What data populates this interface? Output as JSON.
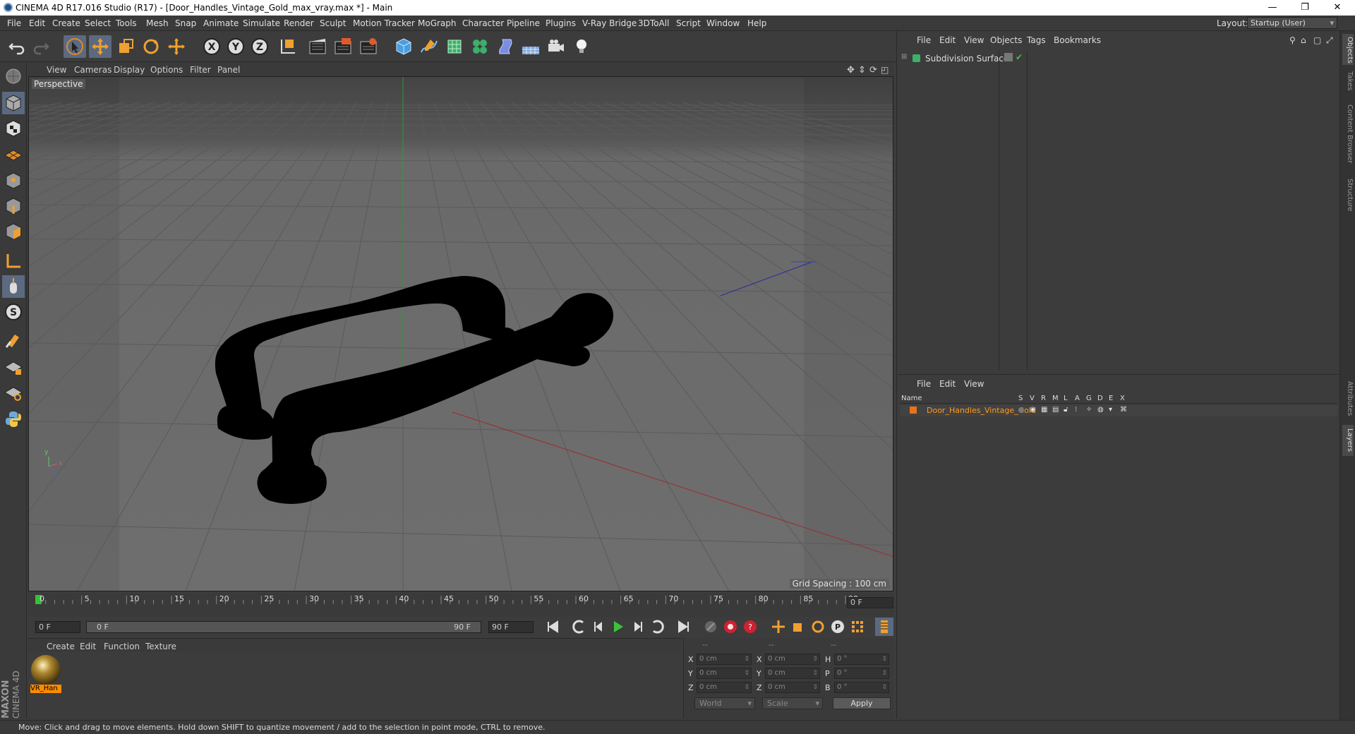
{
  "window": {
    "title": "CINEMA 4D R17.016 Studio (R17) - [Door_Handles_Vintage_Gold_max_vray.max *] - Main",
    "minimize": "—",
    "restore": "❐",
    "close": "✕"
  },
  "menubar": {
    "items": [
      "File",
      "Edit",
      "Create",
      "Select",
      "Tools",
      "Mesh",
      "Snap",
      "Animate",
      "Simulate",
      "Render",
      "Sculpt",
      "Motion Tracker",
      "MoGraph",
      "Character",
      "Pipeline",
      "Plugins",
      "V-Ray Bridge",
      "3DToAll",
      "Script",
      "Window",
      "Help"
    ],
    "layout_label": "Layout:",
    "layout_value": "Startup (User)"
  },
  "toolbar": {
    "icons": [
      "undo-icon",
      "redo-icon",
      "live-selection-icon",
      "move-icon",
      "scale-icon",
      "rotate-icon",
      "recent-tool-icon",
      "x-axis-lock-icon",
      "y-axis-lock-icon",
      "z-axis-lock-icon",
      "coordinate-system-icon",
      "render-view-icon",
      "render-to-picture-viewer-icon",
      "edit-render-settings-icon",
      "cube-object-icon",
      "spline-pen-icon",
      "subdivision-surface-icon",
      "cloner-icon",
      "deformer-icon",
      "floor-icon",
      "camera-icon",
      "light-icon"
    ],
    "axis_labels": [
      "X",
      "Y",
      "Z"
    ]
  },
  "left_tools": [
    "make-editable-icon",
    "model-mode-icon",
    "texture-mode-icon",
    "workplane-mode-icon",
    "points-mode-icon",
    "edges-mode-icon",
    "polygons-mode-icon",
    "axis-mode-icon",
    "tweak-mode-icon",
    "solo-mode-icon",
    "snap-icon",
    "workplane-lock-icon",
    "quantize-icon",
    "python-icon"
  ],
  "viewport": {
    "menu": [
      "View",
      "Cameras",
      "Display",
      "Options",
      "Filter",
      "Panel"
    ],
    "label": "Perspective",
    "grid_spacing": "Grid Spacing : 100 cm",
    "axis_y": "y",
    "axis_x": "x",
    "axis_z": "z"
  },
  "timeline": {
    "ticks": [
      "0",
      "5",
      "10",
      "15",
      "20",
      "25",
      "30",
      "35",
      "40",
      "45",
      "50",
      "55",
      "60",
      "65",
      "70",
      "75",
      "80",
      "85",
      "90"
    ],
    "current_frame_field": "0 F",
    "start_field": "0 F",
    "range_start": "0 F",
    "range_end": "90 F",
    "end_field": "90 F"
  },
  "material_manager": {
    "menu": [
      "Create",
      "Edit",
      "Function",
      "Texture"
    ],
    "material_name": "VR_Han"
  },
  "coordinates": {
    "headers": [
      "--",
      "--",
      "--"
    ],
    "rows": [
      {
        "a": "X",
        "av": "0 cm",
        "b": "X",
        "bv": "0 cm",
        "c": "H",
        "cv": "0 °"
      },
      {
        "a": "Y",
        "av": "0 cm",
        "b": "Y",
        "bv": "0 cm",
        "c": "P",
        "cv": "0 °"
      },
      {
        "a": "Z",
        "av": "0 cm",
        "b": "Z",
        "bv": "0 cm",
        "c": "B",
        "cv": "0 °"
      }
    ],
    "world": "World",
    "scale": "Scale",
    "apply": "Apply"
  },
  "object_manager": {
    "menu": [
      "File",
      "Edit",
      "View",
      "Objects",
      "Tags",
      "Bookmarks"
    ],
    "objects": [
      {
        "name": "Subdivision Surface"
      }
    ]
  },
  "layer_manager": {
    "menu": [
      "File",
      "Edit",
      "View"
    ],
    "columns": [
      "Name",
      "S",
      "V",
      "R",
      "M",
      "L",
      "A",
      "G",
      "D",
      "E",
      "X"
    ],
    "layers": [
      {
        "name": "Door_Handles_Vintage_Gold",
        "color": "#e8731c"
      }
    ]
  },
  "right_tabs": [
    "Objects",
    "Takes",
    "Content Browser",
    "Structure",
    "Attributes",
    "Layers"
  ],
  "status": "Move: Click and drag to move elements. Hold down SHIFT to quantize movement / add to the selection in point mode, CTRL to remove.",
  "brand": [
    "MAXON",
    "CINEMA 4D"
  ],
  "colors": {
    "accent": "#5b6a80",
    "layer_text": "#ff9a1e",
    "play": "#3ac43a"
  }
}
